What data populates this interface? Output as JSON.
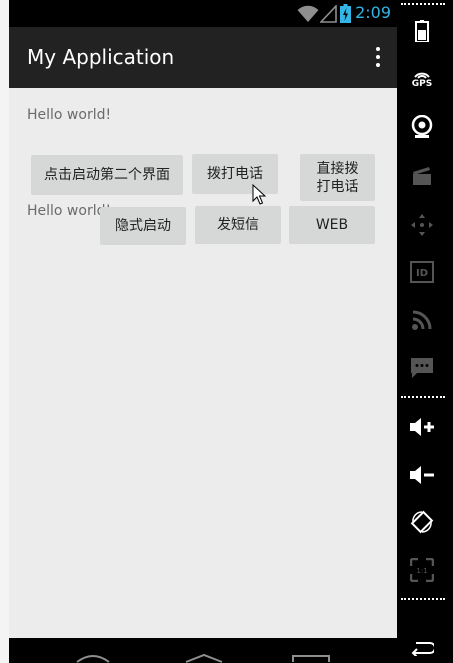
{
  "status_bar": {
    "time": "2:09"
  },
  "app": {
    "title": "My Application"
  },
  "content": {
    "text1": "Hello world!",
    "text2": "Hello world!",
    "buttons": {
      "start_second": "点击启动第二个界面",
      "dial": "拨打电话",
      "direct_dial_line1": "直接拨",
      "direct_dial_line2": "打电话",
      "implicit": "隐式启动",
      "sms": "发短信",
      "web": "WEB"
    }
  },
  "side_panel": {
    "gps_label": "GPS"
  },
  "colors": {
    "status_time": "#33b5e5",
    "action_bar": "#222222",
    "content_bg": "#ececec",
    "button_bg": "#d6d7d7"
  }
}
